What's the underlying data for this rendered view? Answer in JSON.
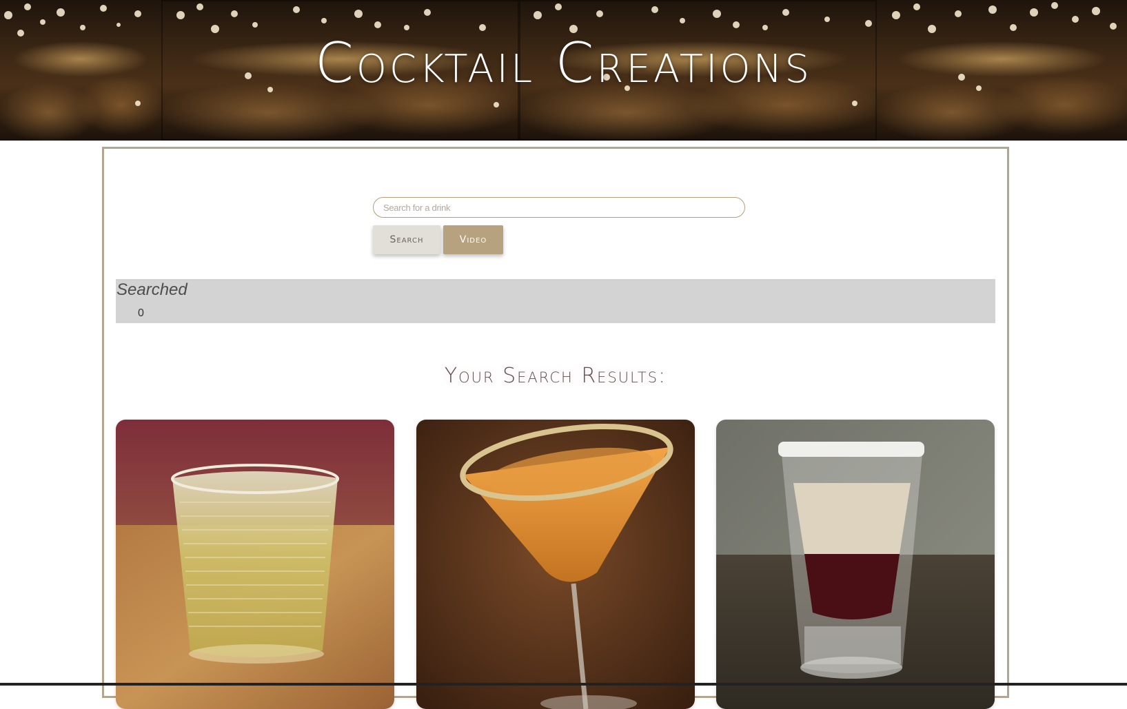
{
  "header": {
    "title": "Cocktail Creations"
  },
  "search": {
    "placeholder": "Search for a drink",
    "value": "",
    "search_button_label": "Search",
    "video_button_label": "Video"
  },
  "searched": {
    "title": "Searched",
    "count": "0"
  },
  "results": {
    "heading": "Your Search Results:",
    "cards": [
      {
        "image_icon": "whiskey-tumbler-drink-image"
      },
      {
        "image_icon": "martini-glass-drink-image"
      },
      {
        "image_icon": "layered-shot-drink-image"
      }
    ]
  },
  "colors": {
    "border_accent": "#b4a58e",
    "video_button": "#b7a280",
    "search_button": "#e2ded8",
    "searched_panel": "#d3d3d3"
  }
}
